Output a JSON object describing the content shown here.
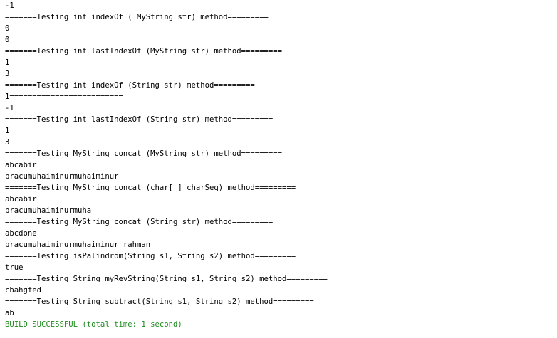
{
  "output": {
    "lines": [
      "-1",
      "=======Testing int indexOf ( MyString str) method=========",
      "0",
      "0",
      "=======Testing int lastIndexOf (MyString str) method=========",
      "1",
      "3",
      "=======Testing int indexOf (String str) method=========",
      "1=========================",
      "-1",
      "=======Testing int lastIndexOf (String str) method=========",
      "1",
      "3",
      "=======Testing MyString concat (MyString str) method=========",
      "abcabir",
      "bracumuhaiminurmuhaiminur",
      "=======Testing MyString concat (char[ ] charSeq) method=========",
      "abcabir",
      "bracumuhaiminurmuha",
      "=======Testing MyString concat (String str) method=========",
      "abcdone",
      "bracumuhaiminurmuhaiminur rahman",
      "=======Testing isPalindrom(String s1, String s2) method=========",
      "true",
      "=======Testing String myRevString(String s1, String s2) method=========",
      "cbahgfed",
      "=======Testing String subtract(String s1, String s2) method=========",
      "ab"
    ],
    "build_status": "BUILD SUCCESSFUL (total time: 1 second)"
  },
  "colors": {
    "text": "#000000",
    "success": "#1f8a1f",
    "background": "#ffffff"
  }
}
